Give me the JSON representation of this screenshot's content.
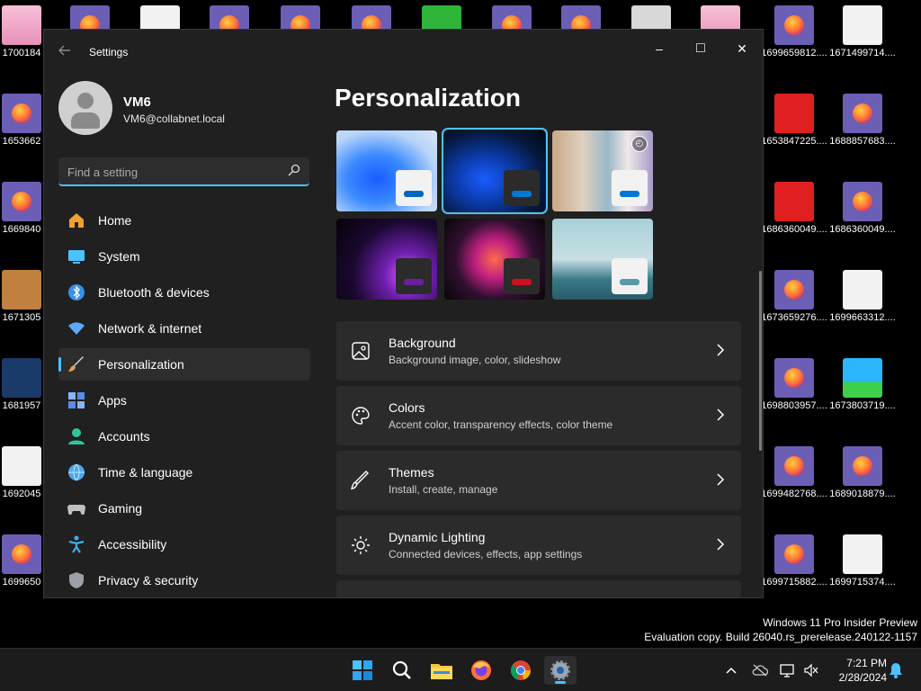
{
  "desktop": {
    "icons": [
      {
        "label": "1700184",
        "kind": "pink"
      },
      {
        "label": "",
        "kind": "firefox"
      },
      {
        "label": "",
        "kind": "white"
      },
      {
        "label": "",
        "kind": "firefox"
      },
      {
        "label": "",
        "kind": "firefox"
      },
      {
        "label": "",
        "kind": "firefox"
      },
      {
        "label": "",
        "kind": "green"
      },
      {
        "label": "",
        "kind": "firefox"
      },
      {
        "label": "",
        "kind": "firefox"
      },
      {
        "label": "",
        "kind": "gray"
      },
      {
        "label": "",
        "kind": "pink"
      },
      {
        "label": "1699659812....",
        "kind": "firefox"
      },
      {
        "label": "1671499714....",
        "kind": "white"
      },
      {
        "label": "1653662",
        "kind": "firefox"
      },
      {
        "label": "1653847225....",
        "kind": "red"
      },
      {
        "label": "1688857683....",
        "kind": "firefox"
      },
      {
        "label": "1669840",
        "kind": "firefox"
      },
      {
        "label": "1686360049....",
        "kind": "red"
      },
      {
        "label": "1686360049....",
        "kind": "firefox"
      },
      {
        "label": "1671305",
        "kind": "brown"
      },
      {
        "label": "1673659276....",
        "kind": "firefox"
      },
      {
        "label": "1699663312....",
        "kind": "white"
      },
      {
        "label": "1681957",
        "kind": "blue"
      },
      {
        "label": "1698803957....",
        "kind": "firefox"
      },
      {
        "label": "1673803719....",
        "kind": "sky"
      },
      {
        "label": "1692045",
        "kind": "white"
      },
      {
        "label": "1699482768....",
        "kind": "firefox"
      },
      {
        "label": "1689018879....",
        "kind": "firefox"
      },
      {
        "label": "1699650",
        "kind": "firefox"
      },
      {
        "label": "1699715882....",
        "kind": "firefox"
      },
      {
        "label": "1699715374....",
        "kind": "white"
      }
    ],
    "watermark_line1": "Windows 11 Pro Insider Preview",
    "watermark_line2": "Evaluation copy. Build 26040.rs_prerelease.240122-1157"
  },
  "window": {
    "title": "Settings",
    "back_icon": "arrow-left-icon",
    "controls": {
      "minimize": "–",
      "maximize": "□",
      "close": "✕"
    }
  },
  "user": {
    "name": "VM6",
    "email": "VM6@collabnet.local"
  },
  "search": {
    "placeholder": "Find a setting",
    "value": ""
  },
  "nav": [
    {
      "label": "Home",
      "icon": "home-icon",
      "color": "#f0a030",
      "active": false
    },
    {
      "label": "System",
      "icon": "system-icon",
      "color": "#4cc2ff",
      "active": false
    },
    {
      "label": "Bluetooth & devices",
      "icon": "bluetooth-icon",
      "color": "#3a8ee6",
      "active": false
    },
    {
      "label": "Network & internet",
      "icon": "wifi-icon",
      "color": "#5aa9ff",
      "active": false
    },
    {
      "label": "Personalization",
      "icon": "brush-icon",
      "color": "#e0a060",
      "active": true
    },
    {
      "label": "Apps",
      "icon": "apps-icon",
      "color": "#8ab4f8",
      "active": false
    },
    {
      "label": "Accounts",
      "icon": "accounts-icon",
      "color": "#2ec4a0",
      "active": false
    },
    {
      "label": "Time & language",
      "icon": "globe-icon",
      "color": "#4ca8e8",
      "active": false
    },
    {
      "label": "Gaming",
      "icon": "gamepad-icon",
      "color": "#c0c0c0",
      "active": false
    },
    {
      "label": "Accessibility",
      "icon": "accessibility-icon",
      "color": "#3ab0f0",
      "active": false
    },
    {
      "label": "Privacy & security",
      "icon": "shield-icon",
      "color": "#9aa0a6",
      "active": false
    }
  ],
  "page": {
    "title": "Personalization"
  },
  "themes": [
    {
      "name": "light-bloom",
      "selected": false,
      "accent": "#0067c0"
    },
    {
      "name": "dark-bloom",
      "selected": true,
      "accent": "#0078d4"
    },
    {
      "name": "spotlight",
      "selected": false,
      "accent": "#0078d4"
    },
    {
      "name": "glow",
      "selected": false,
      "accent": "#6a1fa0"
    },
    {
      "name": "captured-motion",
      "selected": false,
      "accent": "#d01020"
    },
    {
      "name": "flow",
      "selected": false,
      "accent": "#5a9aaa"
    }
  ],
  "settings": [
    {
      "title": "Background",
      "subtitle": "Background image, color, slideshow",
      "icon": "picture-icon"
    },
    {
      "title": "Colors",
      "subtitle": "Accent color, transparency effects, color theme",
      "icon": "palette-icon"
    },
    {
      "title": "Themes",
      "subtitle": "Install, create, manage",
      "icon": "brush-pen-icon"
    },
    {
      "title": "Dynamic Lighting",
      "subtitle": "Connected devices, effects, app settings",
      "icon": "sun-lighting-icon"
    }
  ],
  "taskbar": {
    "apps": [
      "start-icon",
      "search-icon",
      "file-explorer-icon",
      "firefox-icon",
      "chrome-icon",
      "settings-gear-icon"
    ],
    "time": "7:21 PM",
    "date": "2/28/2024"
  },
  "colors": {
    "accent": "#4cc2ff",
    "window_bg": "#202020",
    "card_bg": "#2b2b2b"
  }
}
